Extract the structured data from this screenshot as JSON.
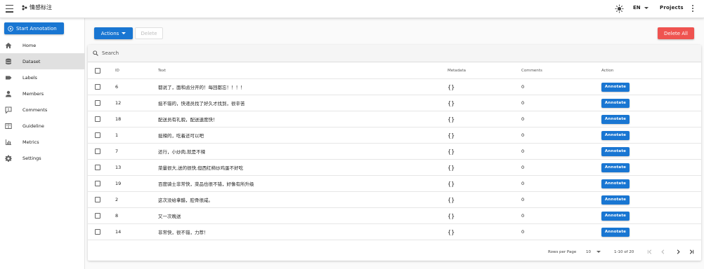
{
  "appbar": {
    "brand": "情感标注",
    "language": "EN",
    "projects_label": "Projects"
  },
  "sidebar": {
    "start_label": "Start Annotation",
    "items": [
      {
        "label": "Home",
        "icon": "home-icon"
      },
      {
        "label": "Dataset",
        "icon": "database-icon",
        "active": true
      },
      {
        "label": "Labels",
        "icon": "label-icon"
      },
      {
        "label": "Members",
        "icon": "person-icon"
      },
      {
        "label": "Comments",
        "icon": "comment-icon"
      },
      {
        "label": "Guideline",
        "icon": "book-icon"
      },
      {
        "label": "Metrics",
        "icon": "chart-icon"
      },
      {
        "label": "Settings",
        "icon": "gear-icon"
      }
    ]
  },
  "toolbar": {
    "actions_label": "Actions",
    "delete_label": "Delete",
    "delete_all_label": "Delete All"
  },
  "search": {
    "placeholder": "Search"
  },
  "table": {
    "headers": {
      "id": "ID",
      "text": "Text",
      "metadata": "Metadata",
      "comments": "Comments",
      "action": "Action"
    },
    "annotate_label": "Annotate",
    "rows": [
      {
        "id": "6",
        "text": "都说了，面和卤分开的！每回都忘！！！！",
        "metadata": "{}",
        "comments": "0"
      },
      {
        "id": "12",
        "text": "挺不错的，快递员找了好久才找到，很辛苦",
        "metadata": "{}",
        "comments": "0"
      },
      {
        "id": "18",
        "text": "配送员有礼貌，配送速度快！",
        "metadata": "{}",
        "comments": "0"
      },
      {
        "id": "1",
        "text": "挺辣的，吃着还可以吧",
        "metadata": "{}",
        "comments": "0"
      },
      {
        "id": "7",
        "text": "还行，小炒肉,就是不辣",
        "metadata": "{}",
        "comments": "0"
      },
      {
        "id": "13",
        "text": "菜量很大,送的很快,但西红柿炒鸡蛋不好吃",
        "metadata": "{}",
        "comments": "0"
      },
      {
        "id": "19",
        "text": "百度骑士非常快，菜品也很不错，好像有所升级",
        "metadata": "{}",
        "comments": "0"
      },
      {
        "id": "2",
        "text": "这次没给拿醋，腔骨很咸。",
        "metadata": "{}",
        "comments": "0"
      },
      {
        "id": "8",
        "text": "又一次晚送",
        "metadata": "{}",
        "comments": "0"
      },
      {
        "id": "14",
        "text": "非常快，很不错，力荐！",
        "metadata": "{}",
        "comments": "0"
      }
    ]
  },
  "footer": {
    "rows_per_page_label": "Rows per Page",
    "rows_per_page_value": "10",
    "range": "1-10 of 20"
  },
  "colors": {
    "primary": "#1976d2",
    "danger": "#ef5350",
    "active_nav": "#e0e0e0"
  }
}
